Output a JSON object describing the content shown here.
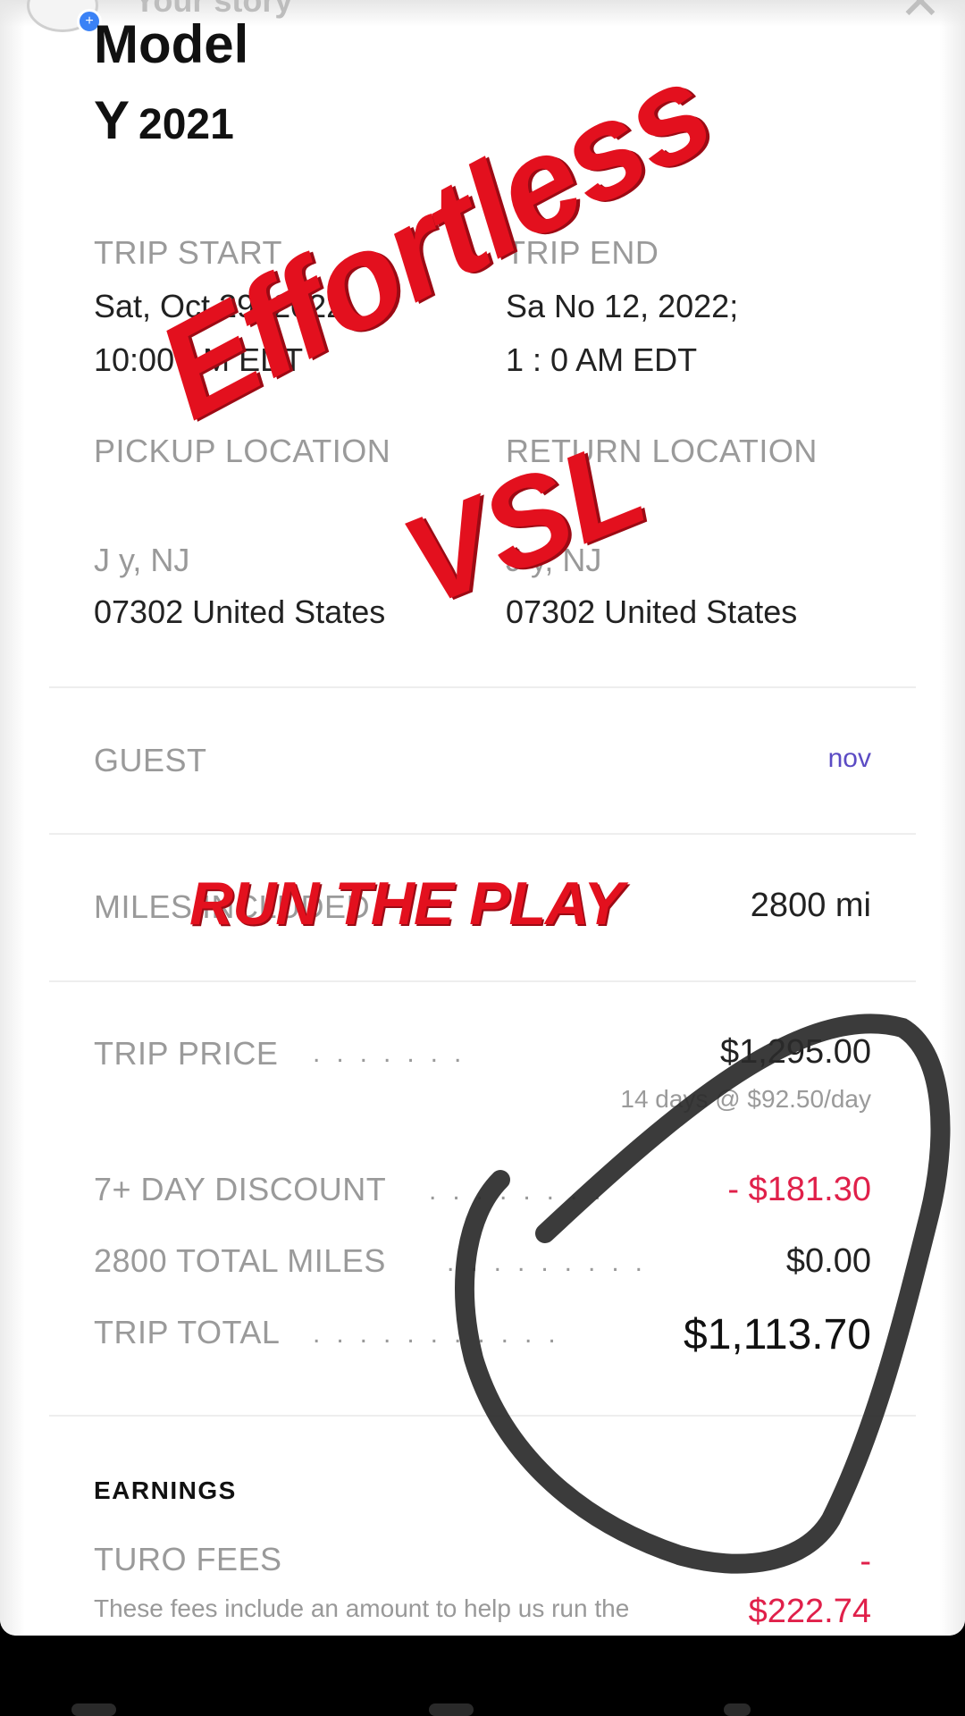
{
  "story": {
    "user": "Your story"
  },
  "vehicle": {
    "title": "Model",
    "model_letter": "Y",
    "year": "2021"
  },
  "trip": {
    "start_label": "TRIP START",
    "start_date": "Sat, Oct 29, 2022;",
    "start_time": "10:00 AM EDT",
    "end_label": "TRIP END",
    "end_date": "Sa  No  12, 2022;",
    "end_time": "1 : 0 AM EDT",
    "pickup_label": "PICKUP LOCATION",
    "pickup_line": "J        y, NJ",
    "pickup_zip": "07302 United States",
    "return_label": "RETURN LOCATION",
    "return_line": "J        y, NJ",
    "return_zip": "07302 United States"
  },
  "guest": {
    "label": "GUEST",
    "name": "nov"
  },
  "miles": {
    "label": "MILES INCLUDED",
    "value": "2800 mi"
  },
  "pricing": {
    "trip_price_label": "TRIP PRICE",
    "trip_price": "$1,295.00",
    "trip_price_note": "14 days @ $92.50/day",
    "discount_label": "7+ DAY DISCOUNT",
    "discount": "- $181.30",
    "total_miles_label": "2800 TOTAL MILES",
    "total_miles_value": "$0.00",
    "trip_total_label": "TRIP TOTAL",
    "trip_total": "$1,113.70"
  },
  "earnings": {
    "heading": "EARNINGS",
    "fees_label": "TURO FEES",
    "fees_dash": "-",
    "fees_desc": "These fees include an amount to help us run the",
    "fees_value": "$222.74"
  },
  "overlay": {
    "effortless": "Effortless",
    "vsl": "VSL",
    "run_the_play": "RUN THE PLAY"
  },
  "colors": {
    "overlay_red": "#e3101e",
    "negative_red": "#e0204a"
  }
}
